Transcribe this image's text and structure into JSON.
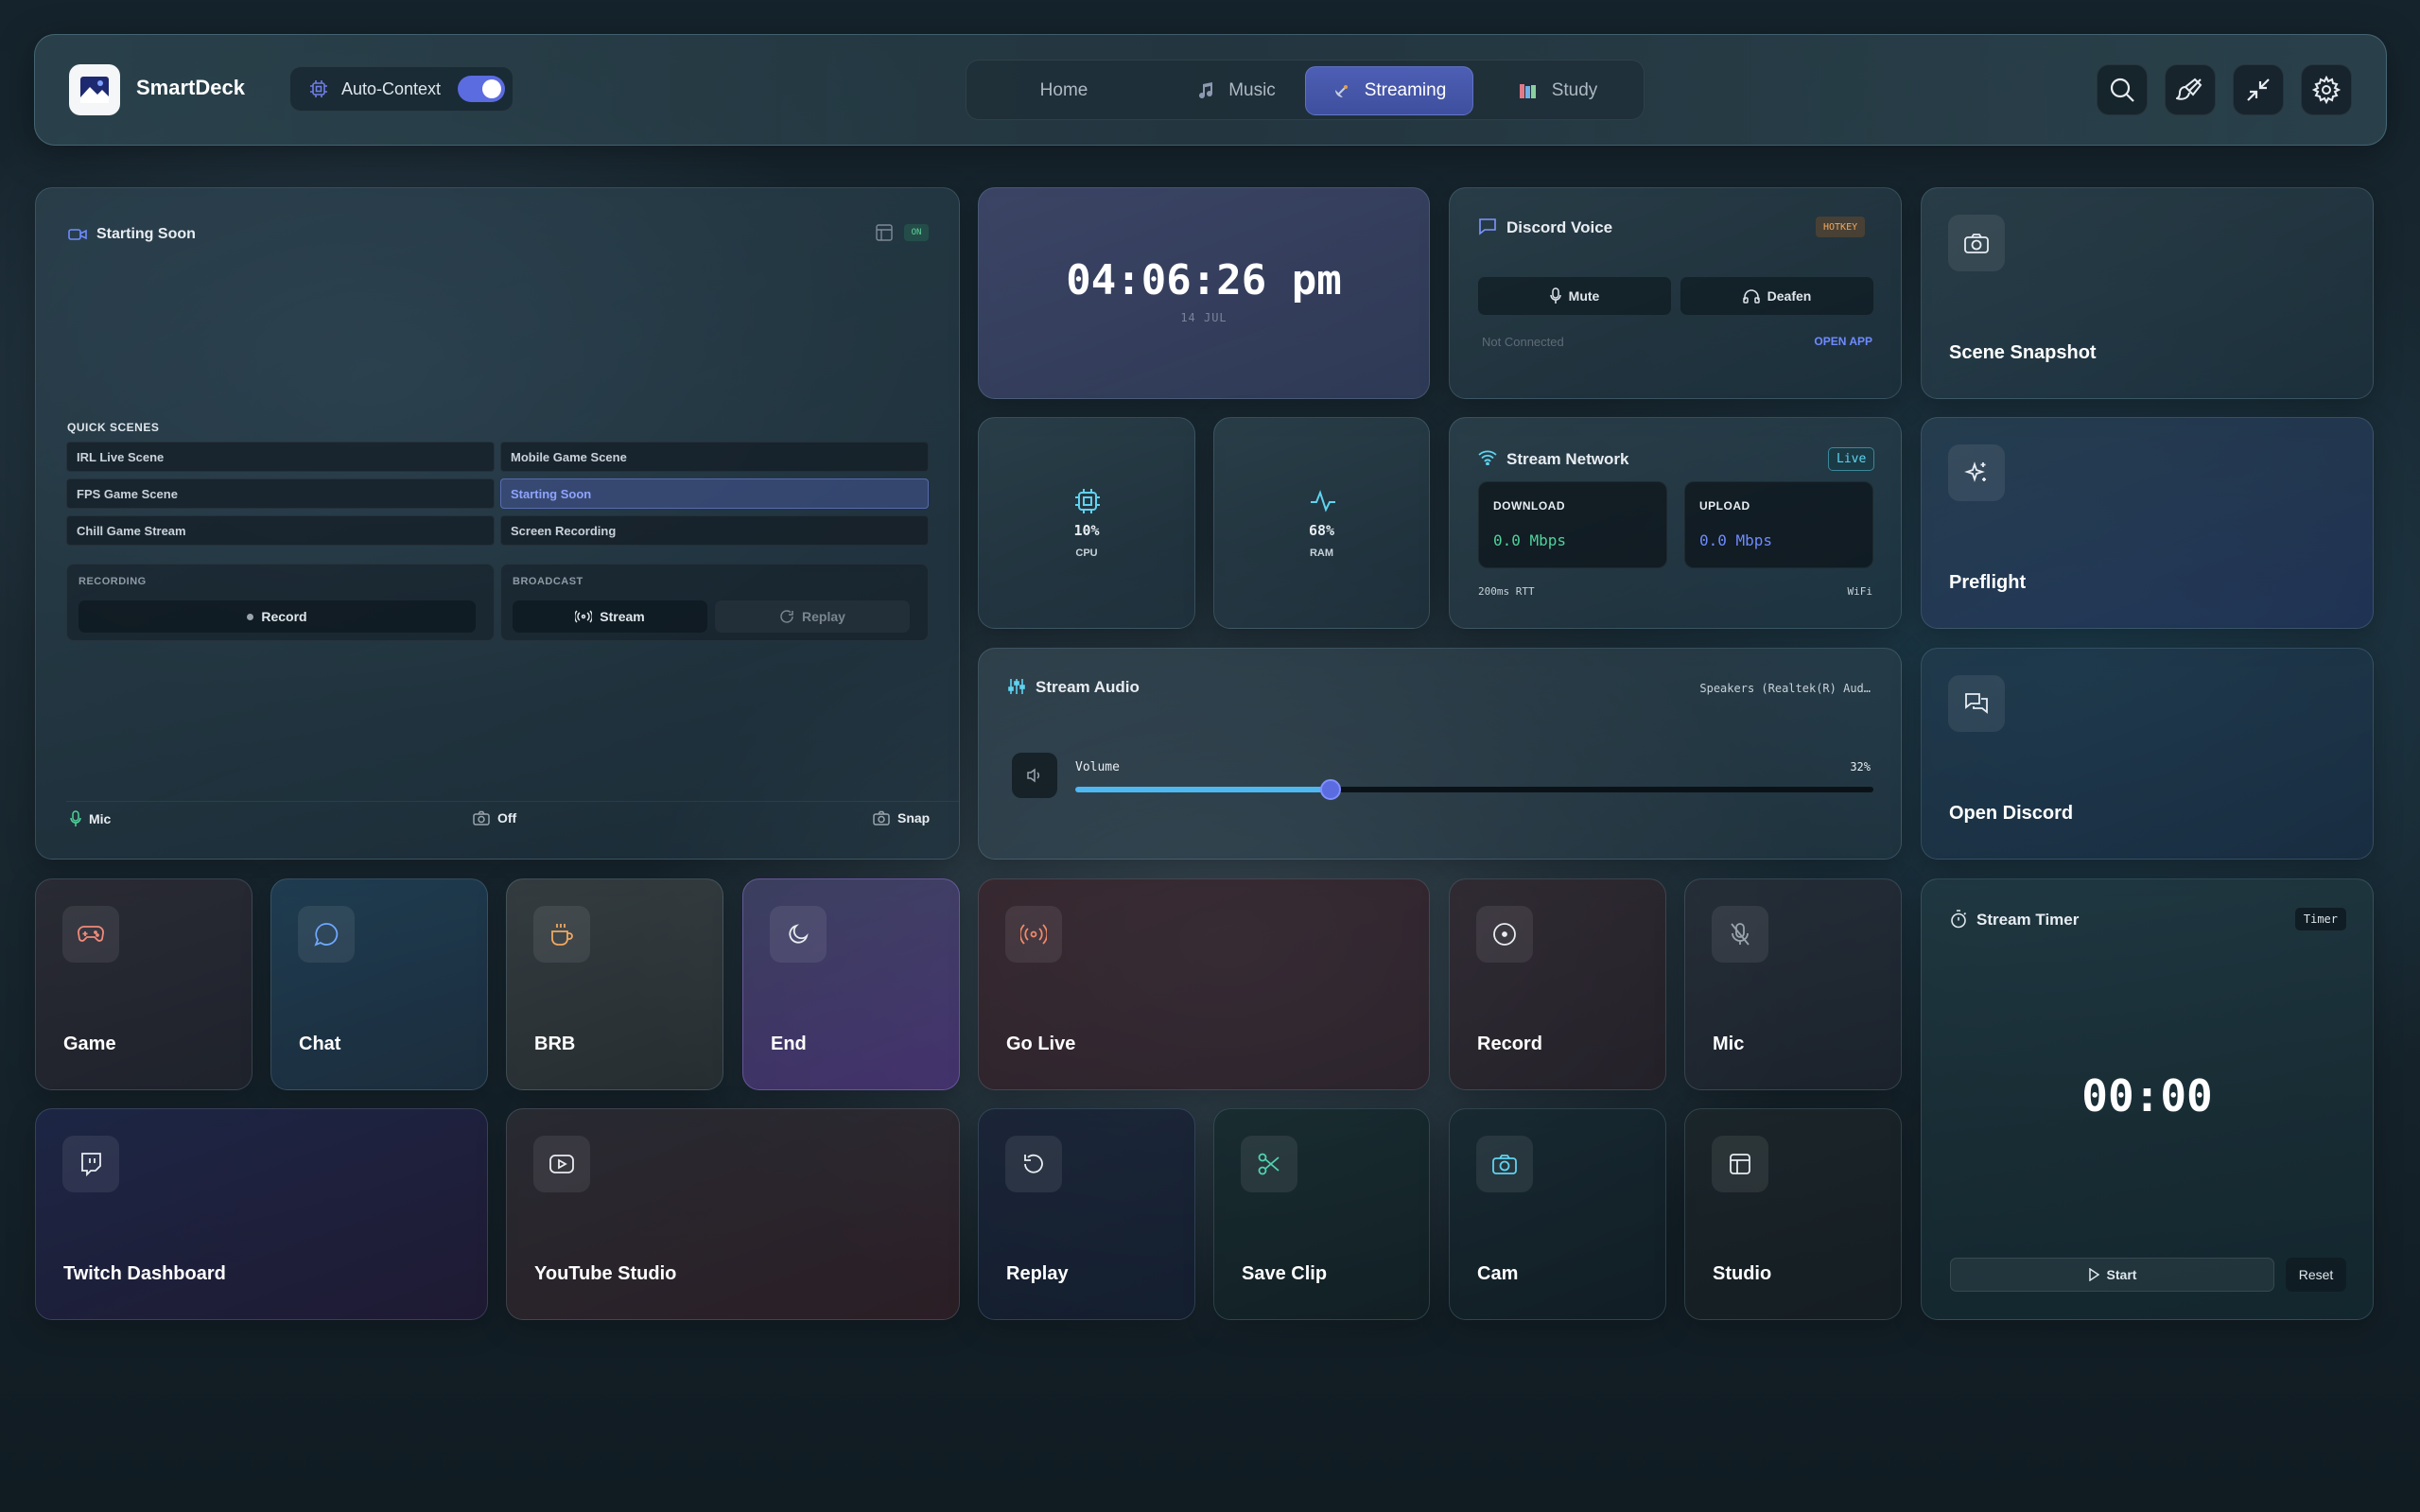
{
  "app": {
    "name": "SmartDeck",
    "auto_context_label": "Auto-Context",
    "auto_context_on": true
  },
  "nav": {
    "tabs": [
      {
        "label": "Home",
        "icon": "none"
      },
      {
        "label": "Music",
        "icon": "music-note-icon"
      },
      {
        "label": "Streaming",
        "icon": "satellite-dish-icon",
        "active": true
      },
      {
        "label": "Study",
        "icon": "books-icon"
      }
    ]
  },
  "header_actions": [
    "search-icon",
    "brush-icon",
    "minimize-icon",
    "gear-icon"
  ],
  "scene_panel": {
    "title": "Starting Soon",
    "status_badge": "ON",
    "quick_scenes_label": "QUICK SCENES",
    "scenes": [
      "IRL Live Scene",
      "Mobile Game Scene",
      "FPS Game Scene",
      "Starting Soon",
      "Chill Game Stream",
      "Screen Recording"
    ],
    "selected_scene": "Starting Soon",
    "recording_label": "RECORDING",
    "record_button": "Record",
    "broadcast_label": "BROADCAST",
    "stream_button": "Stream",
    "replay_button": "Replay",
    "footer": {
      "mic": "Mic",
      "cam": "Off",
      "snap": "Snap"
    }
  },
  "clock": {
    "time": "04:06:26 pm",
    "date": "14 JUL"
  },
  "cpu": {
    "value": "10%",
    "label": "CPU"
  },
  "ram": {
    "value": "68%",
    "label": "RAM"
  },
  "discord": {
    "title": "Discord Voice",
    "badge": "HOTKEY",
    "mute": "Mute",
    "deafen": "Deafen",
    "status": "Not Connected",
    "open_app": "OPEN APP"
  },
  "network": {
    "title": "Stream Network",
    "badge": "Live",
    "download_label": "DOWNLOAD",
    "download_value": "0.0 Mbps",
    "upload_label": "UPLOAD",
    "upload_value": "0.0 Mbps",
    "rtt": "200ms RTT",
    "connection": "WiFi"
  },
  "audio": {
    "title": "Stream Audio",
    "device": "Speakers (Realtek(R) Aud…",
    "volume_label": "Volume",
    "volume_text": "32%",
    "volume_fraction": 0.32
  },
  "right_tiles": [
    {
      "label": "Scene Snapshot",
      "icon": "camera-icon"
    },
    {
      "label": "Preflight",
      "icon": "sparkles-icon"
    },
    {
      "label": "Open Discord",
      "icon": "chat-bubbles-icon"
    }
  ],
  "tiles": {
    "game": "Game",
    "chat": "Chat",
    "brb": "BRB",
    "end": "End",
    "go_live": "Go Live",
    "record": "Record",
    "mic": "Mic",
    "twitch": "Twitch Dashboard",
    "youtube": "YouTube Studio",
    "replay": "Replay",
    "save_clip": "Save Clip",
    "cam": "Cam",
    "studio": "Studio"
  },
  "timer": {
    "title": "Stream Timer",
    "badge": "Timer",
    "value": "00:00",
    "start": "Start",
    "reset": "Reset"
  },
  "colors": {
    "accent": "#5b6be0",
    "live_cyan": "#5fd3f0",
    "download_green": "#4fd39a",
    "upload_blue": "#6f8bff"
  }
}
